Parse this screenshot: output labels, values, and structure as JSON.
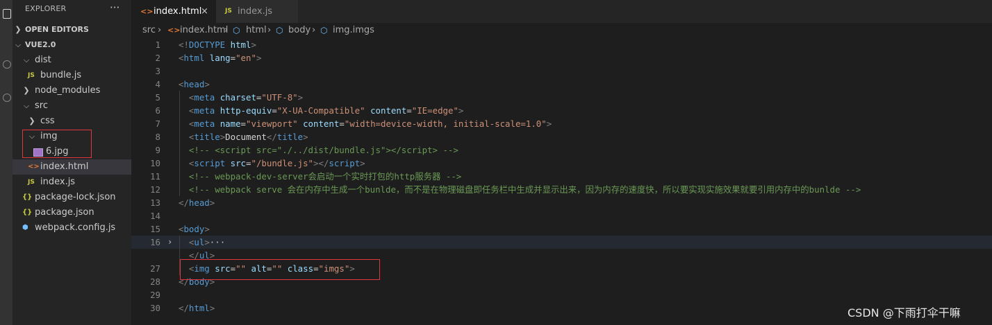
{
  "sidebar": {
    "header": "EXPLORER",
    "more": "···",
    "open_editors": "OPEN EDITORS",
    "project": "VUE2.0",
    "items": [
      {
        "label": "dist",
        "icon": "chevron-down-icon"
      },
      {
        "label": "bundle.js",
        "icon": "js-file-icon",
        "badge": "JS"
      },
      {
        "label": "node_modules",
        "icon": "chevron-right-icon"
      },
      {
        "label": "src",
        "icon": "chevron-down-icon"
      },
      {
        "label": "css",
        "icon": "chevron-right-icon"
      },
      {
        "label": "img",
        "icon": "chevron-down-icon"
      },
      {
        "label": "6.jpg",
        "icon": "image-file-icon"
      },
      {
        "label": "index.html",
        "icon": "html-file-icon",
        "badge": "<>"
      },
      {
        "label": "index.js",
        "icon": "js-file-icon",
        "badge": "JS"
      },
      {
        "label": "package-lock.json",
        "icon": "json-file-icon",
        "badge": "{}"
      },
      {
        "label": "package.json",
        "icon": "json-file-icon",
        "badge": "{}"
      },
      {
        "label": "webpack.config.js",
        "icon": "webpack-icon",
        "badge": "⬢"
      }
    ]
  },
  "tabs": [
    {
      "label": "index.html",
      "badge": "<>",
      "active": true,
      "close": "×"
    },
    {
      "label": "index.js",
      "badge": "JS",
      "active": false
    }
  ],
  "breadcrumb": {
    "parts": [
      "src",
      "index.html",
      "html",
      "body",
      "img.imgs"
    ],
    "sep": "›",
    "cube": "⬡"
  },
  "editor": {
    "lines": [
      {
        "n": "1",
        "html": "<span class='t-punc'>&lt;!</span><span class='t-tag'>DOCTYPE</span> <span class='t-attr'>html</span><span class='t-punc'>&gt;</span>"
      },
      {
        "n": "2",
        "html": "<span class='t-punc'>&lt;</span><span class='t-tag'>html</span> <span class='t-attr'>lang</span><span class='t-txt'>=</span><span class='t-str'>\"en\"</span><span class='t-punc'>&gt;</span>"
      },
      {
        "n": "3",
        "html": ""
      },
      {
        "n": "4",
        "html": "<span class='t-punc'>&lt;</span><span class='t-tag'>head</span><span class='t-punc'>&gt;</span>"
      },
      {
        "n": "5",
        "html": "  <span class='t-punc'>&lt;</span><span class='t-tag'>meta</span> <span class='t-attr'>charset</span><span class='t-txt'>=</span><span class='t-str'>\"UTF-8\"</span><span class='t-punc'>&gt;</span>"
      },
      {
        "n": "6",
        "html": "  <span class='t-punc'>&lt;</span><span class='t-tag'>meta</span> <span class='t-attr'>http-equiv</span><span class='t-txt'>=</span><span class='t-str'>\"X-UA-Compatible\"</span> <span class='t-attr'>content</span><span class='t-txt'>=</span><span class='t-str'>\"IE=edge\"</span><span class='t-punc'>&gt;</span>"
      },
      {
        "n": "7",
        "html": "  <span class='t-punc'>&lt;</span><span class='t-tag'>meta</span> <span class='t-attr'>name</span><span class='t-txt'>=</span><span class='t-str'>\"viewport\"</span> <span class='t-attr'>content</span><span class='t-txt'>=</span><span class='t-str'>\"width=device-width, initial-scale=1.0\"</span><span class='t-punc'>&gt;</span>"
      },
      {
        "n": "8",
        "html": "  <span class='t-punc'>&lt;</span><span class='t-tag'>title</span><span class='t-punc'>&gt;</span><span class='t-txt'>Document</span><span class='t-punc'>&lt;/</span><span class='t-tag'>title</span><span class='t-punc'>&gt;</span>"
      },
      {
        "n": "9",
        "html": "  <span class='t-com'>&lt;!-- &lt;script src=\"./../dist/bundle.js\"&gt;&lt;/script&gt; --&gt;</span>"
      },
      {
        "n": "10",
        "html": "  <span class='t-punc'>&lt;</span><span class='t-tag'>script</span> <span class='t-attr'>src</span><span class='t-txt'>=</span><span class='t-str'>\"/bundle.js\"</span><span class='t-punc'>&gt;&lt;/</span><span class='t-tag'>script</span><span class='t-punc'>&gt;</span>"
      },
      {
        "n": "11",
        "html": "  <span class='t-com'>&lt;!-- webpack-dev-server会启动一个实时打包的http服务器 --&gt;</span>"
      },
      {
        "n": "12",
        "html": "  <span class='t-com'>&lt;!-- webpack serve 会在内存中生成一个bunlde，而不是在物理磁盘即任务栏中生成并显示出来，因为内存的速度快，所以要实现实施效果就要引用内存中的bunlde --&gt;</span>"
      },
      {
        "n": "13",
        "html": "<span class='t-punc'>&lt;/</span><span class='t-tag'>head</span><span class='t-punc'>&gt;</span>"
      },
      {
        "n": "14",
        "html": ""
      },
      {
        "n": "15",
        "html": "<span class='t-punc'>&lt;</span><span class='t-tag'>body</span><span class='t-punc'>&gt;</span>"
      },
      {
        "n": "16",
        "html": "  <span class='t-punc'>&lt;</span><span class='t-tag'>ul</span><span class='t-punc'>&gt;</span><span class='t-ell'>···</span>",
        "fold": "›"
      },
      {
        "n": "",
        "html": "  <span class='t-punc'>&lt;/</span><span class='t-tag'>ul</span><span class='t-punc'>&gt;</span>"
      },
      {
        "n": "27",
        "html": "  <span class='t-punc'>&lt;</span><span class='t-tag'>img</span> <span class='t-attr'>src</span><span class='t-txt'>=</span><span class='t-str'>\"\"</span> <span class='t-attr'>alt</span><span class='t-txt'>=</span><span class='t-str'>\"\"</span> <span class='t-attr'>class</span><span class='t-txt'>=</span><span class='t-str'>\"imgs\"</span><span class='t-punc'>&gt;</span>"
      },
      {
        "n": "28",
        "html": "<span class='t-punc'>&lt;/</span><span class='t-tag'>body</span><span class='t-punc'>&gt;</span>"
      },
      {
        "n": "29",
        "html": ""
      },
      {
        "n": "30",
        "html": "<span class='t-punc'>&lt;/</span><span class='t-tag'>html</span><span class='t-punc'>&gt;</span>"
      }
    ]
  },
  "watermark": "CSDN @下雨打伞干嘛"
}
